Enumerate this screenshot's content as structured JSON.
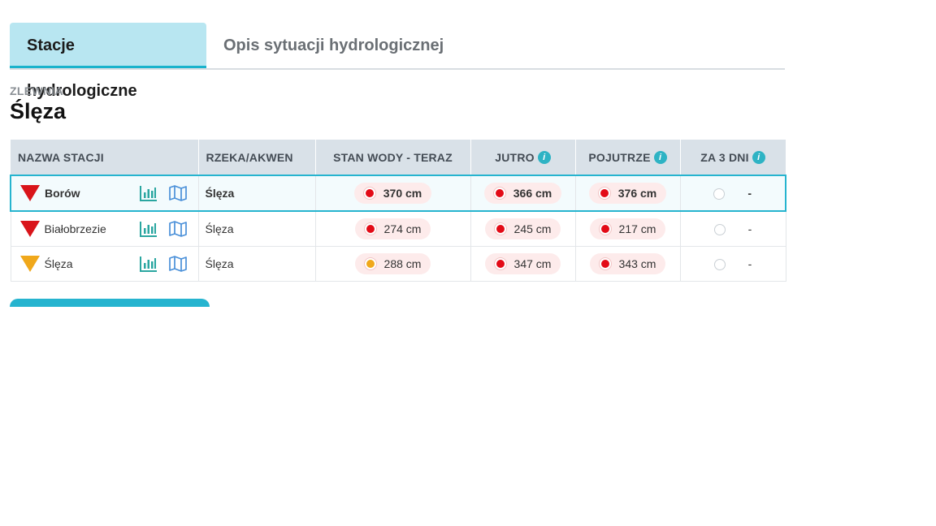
{
  "tabs": [
    {
      "label": "Stacje hydrologiczne",
      "active": true
    },
    {
      "label": "Opis sytuacji hydrologicznej",
      "active": false
    }
  ],
  "catchment": {
    "label": "ZLEWNIA",
    "name": "Ślęza"
  },
  "table": {
    "headers": {
      "station": "NAZWA STACJI",
      "river": "RZEKA/AKWEN",
      "now": "STAN WODY - TERAZ",
      "tomorrow": "JUTRO",
      "day_after": "POJUTRZE",
      "in3days": "ZA 3 DNI"
    },
    "info_icon": "i",
    "rows": [
      {
        "station": "Borów",
        "river": "Ślęza",
        "now": "370 cm",
        "tomorrow": "366 cm",
        "day_after": "376 cm",
        "in3days": "-"
      },
      {
        "station": "Białobrzezie",
        "river": "Ślęza",
        "now": "274 cm",
        "tomorrow": "245 cm",
        "day_after": "217 cm",
        "in3days": "-"
      },
      {
        "station": "Ślęza",
        "river": "Ślęza",
        "now": "288 cm",
        "tomorrow": "347 cm",
        "day_after": "343 cm",
        "in3days": "-"
      }
    ]
  },
  "colors": {
    "accent": "#26b4cf",
    "alarm": "#e30b17",
    "warning": "#f0a81b",
    "header_bg": "#d9e1e8"
  },
  "icons": {
    "chart": "bar-chart-icon",
    "map": "map-icon",
    "alarm": "red-triangle-icon",
    "warning": "orange-triangle-icon"
  }
}
